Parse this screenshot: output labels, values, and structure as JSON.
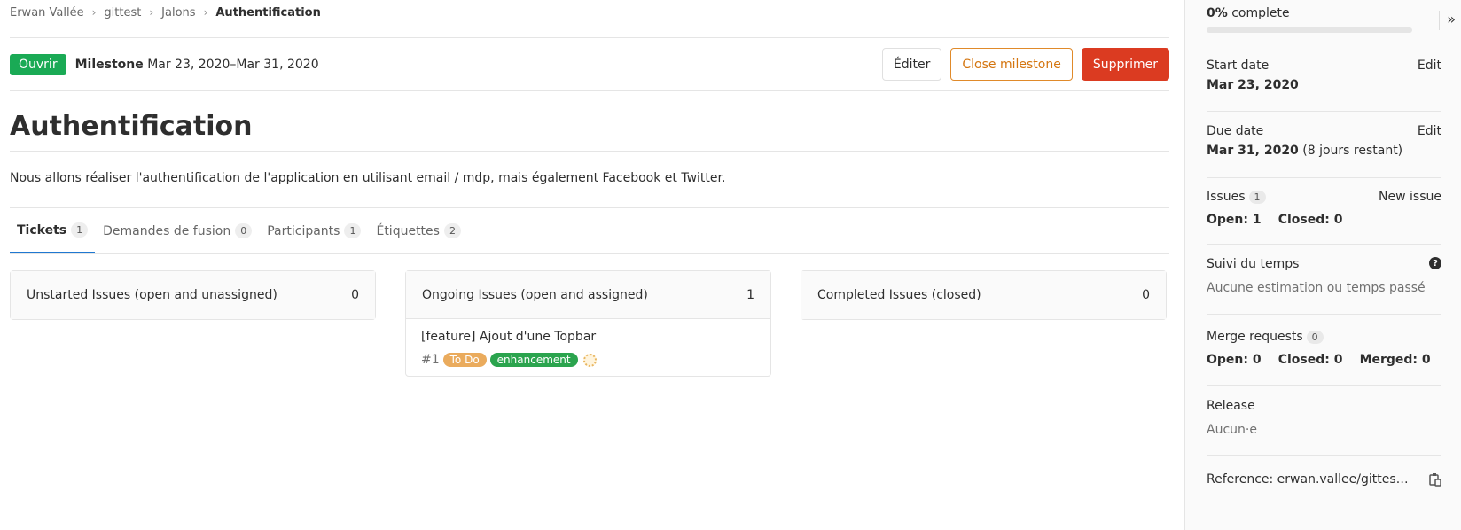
{
  "breadcrumb": {
    "items": [
      "Erwan Vallée",
      "gittest",
      "Jalons"
    ],
    "current": "Authentification"
  },
  "header": {
    "status": "Ouvrir",
    "milestone_label": "Milestone",
    "dates": "Mar 23, 2020–Mar 31, 2020",
    "edit_btn": "Éditer",
    "close_btn": "Close milestone",
    "delete_btn": "Supprimer"
  },
  "title": "Authentification",
  "description": "Nous allons réaliser l'authentification de l'application en utilisant email / mdp, mais également Facebook et Twitter.",
  "tabs": [
    {
      "label": "Tickets",
      "count": "1"
    },
    {
      "label": "Demandes de fusion",
      "count": "0"
    },
    {
      "label": "Participants",
      "count": "1"
    },
    {
      "label": "Étiquettes",
      "count": "2"
    }
  ],
  "panels": [
    {
      "title": "Unstarted Issues (open and unassigned)",
      "count": "0"
    },
    {
      "title": "Ongoing Issues (open and assigned)",
      "count": "1"
    },
    {
      "title": "Completed Issues (closed)",
      "count": "0"
    }
  ],
  "issue": {
    "title": "[feature] Ajout d'une Topbar",
    "number": "#1",
    "labels": [
      "To Do",
      "enhancement"
    ]
  },
  "sidebar": {
    "progress_pct": "0%",
    "progress_word": "complete",
    "progress_fraction": 0,
    "start_label": "Start date",
    "start_value": "Mar 23, 2020",
    "due_label": "Due date",
    "due_value": "Mar 31, 2020",
    "due_remaining": "(8 jours restant)",
    "edit": "Edit",
    "issues_label": "Issues",
    "issues_count": "1",
    "new_issue": "New issue",
    "open_label": "Open: 1",
    "closed_label": "Closed: 0",
    "time_label": "Suivi du temps",
    "time_value": "Aucune estimation ou temps passé",
    "mr_label": "Merge requests",
    "mr_count": "0",
    "mr_open": "Open: 0",
    "mr_closed": "Closed: 0",
    "mr_merged": "Merged: 0",
    "release_label": "Release",
    "release_value": "Aucun·e",
    "reference": "Reference: erwan.vallee/gittes…"
  }
}
